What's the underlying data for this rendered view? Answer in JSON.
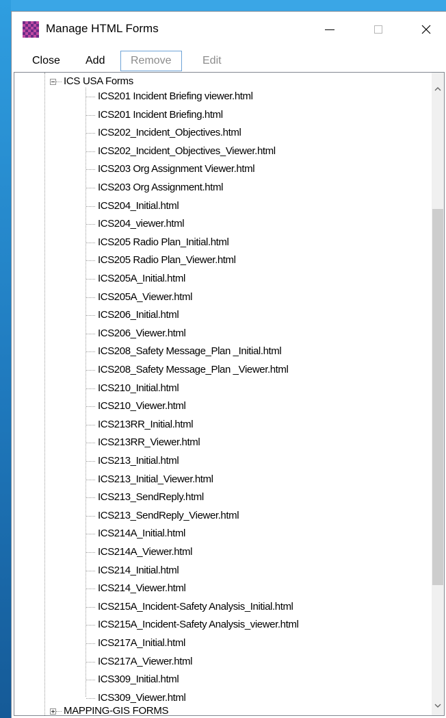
{
  "window": {
    "title": "Manage HTML Forms",
    "icon": "checkered-grid-icon",
    "controls": [
      "minimize-icon",
      "maximize-icon",
      "close-icon"
    ]
  },
  "menu": {
    "close_label": "Close",
    "add_label": "Add",
    "remove_label": "Remove",
    "edit_label": "Edit"
  },
  "tree": {
    "root_label": "ICS USA Forms",
    "files": [
      "ICS201 Incident Briefing viewer.html",
      "ICS201 Incident Briefing.html",
      "ICS202_Incident_Objectives.html",
      "ICS202_Incident_Objectives_Viewer.html",
      "ICS203 Org Assignment Viewer.html",
      "ICS203 Org Assignment.html",
      "ICS204_Initial.html",
      "ICS204_viewer.html",
      "ICS205 Radio Plan_Initial.html",
      "ICS205 Radio Plan_Viewer.html",
      "ICS205A_Initial.html",
      "ICS205A_Viewer.html",
      "ICS206_Initial.html",
      "ICS206_Viewer.html",
      "ICS208_Safety Message_Plan _Initial.html",
      "ICS208_Safety Message_Plan _Viewer.html",
      "ICS210_Initial.html",
      "ICS210_Viewer.html",
      "ICS213RR_Initial.html",
      "ICS213RR_Viewer.html",
      "ICS213_Initial.html",
      "ICS213_Initial_Viewer.html",
      "ICS213_SendReply.html",
      "ICS213_SendReply_Viewer.html",
      "ICS214A_Initial.html",
      "ICS214A_Viewer.html",
      "ICS214_Initial.html",
      "ICS214_Viewer.html",
      "ICS215A_Incident-Safety Analysis_Initial.html",
      "ICS215A_Incident-Safety Analysis_viewer.html",
      "ICS217A_Initial.html",
      "ICS217A_Viewer.html",
      "ICS309_Initial.html",
      "ICS309_Viewer.html"
    ],
    "next_root_label": "MAPPING-GIS FORMS"
  }
}
